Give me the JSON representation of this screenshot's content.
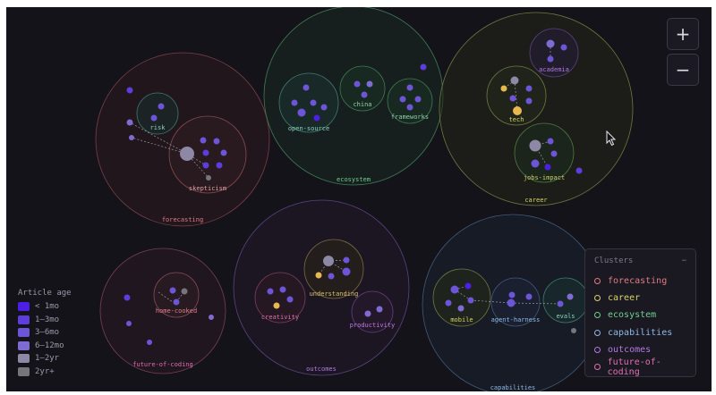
{
  "zoom": {
    "in_label": "+",
    "out_label": "−"
  },
  "age_legend": {
    "title": "Article age",
    "items": [
      {
        "label": "< 1mo",
        "color": "#4c1fe6"
      },
      {
        "label": "1–3mo",
        "color": "#5d3ddc"
      },
      {
        "label": "3–6mo",
        "color": "#6d55d8"
      },
      {
        "label": "6–12mo",
        "color": "#7f6cd2"
      },
      {
        "label": "1–2yr",
        "color": "#8c88a6"
      },
      {
        "label": "2yr+",
        "color": "#76757c"
      }
    ]
  },
  "clusters_panel": {
    "title": "Clusters",
    "collapse_label": "−",
    "items": [
      {
        "label": "forecasting",
        "color": "#e07b84"
      },
      {
        "label": "career",
        "color": "#d7d46a"
      },
      {
        "label": "ecosystem",
        "color": "#6fd08c"
      },
      {
        "label": "capabilities",
        "color": "#8fb8e8"
      },
      {
        "label": "outcomes",
        "color": "#b07ae0"
      },
      {
        "label": "future-of-coding",
        "color": "#e070b0"
      }
    ]
  },
  "map": {
    "clusters": [
      {
        "name": "forecasting-cluster",
        "label": "forecasting",
        "color": "#e07b84"
      },
      {
        "name": "ecosystem-cluster",
        "label": "ecosystem",
        "color": "#6fd08c"
      },
      {
        "name": "career-cluster",
        "label": "career",
        "color": "#d7d46a"
      },
      {
        "name": "future-of-coding-cluster",
        "label": "future-of-coding",
        "color": "#e070b0"
      },
      {
        "name": "outcomes-cluster",
        "label": "outcomes",
        "color": "#b07ae0"
      },
      {
        "name": "capabilities-cluster",
        "label": "capabilities",
        "color": "#8fb8e8"
      }
    ],
    "topics": [
      {
        "name": "topic-risk",
        "label": "risk"
      },
      {
        "name": "topic-skepticism",
        "label": "skepticism"
      },
      {
        "name": "topic-open-source",
        "label": "open-source"
      },
      {
        "name": "topic-china",
        "label": "china"
      },
      {
        "name": "topic-frameworks",
        "label": "frameworks"
      },
      {
        "name": "topic-academia",
        "label": "academia"
      },
      {
        "name": "topic-tech",
        "label": "tech"
      },
      {
        "name": "topic-jobs-impact",
        "label": "jobs-impact"
      },
      {
        "name": "topic-home-cooked",
        "label": "home-cooked"
      },
      {
        "name": "topic-creativity",
        "label": "creativity"
      },
      {
        "name": "topic-understanding",
        "label": "understanding"
      },
      {
        "name": "topic-productivity",
        "label": "productivity"
      },
      {
        "name": "topic-mobile",
        "label": "mobile"
      },
      {
        "name": "topic-agent-harness",
        "label": "agent-harness"
      },
      {
        "name": "topic-evals",
        "label": "evals"
      }
    ]
  }
}
